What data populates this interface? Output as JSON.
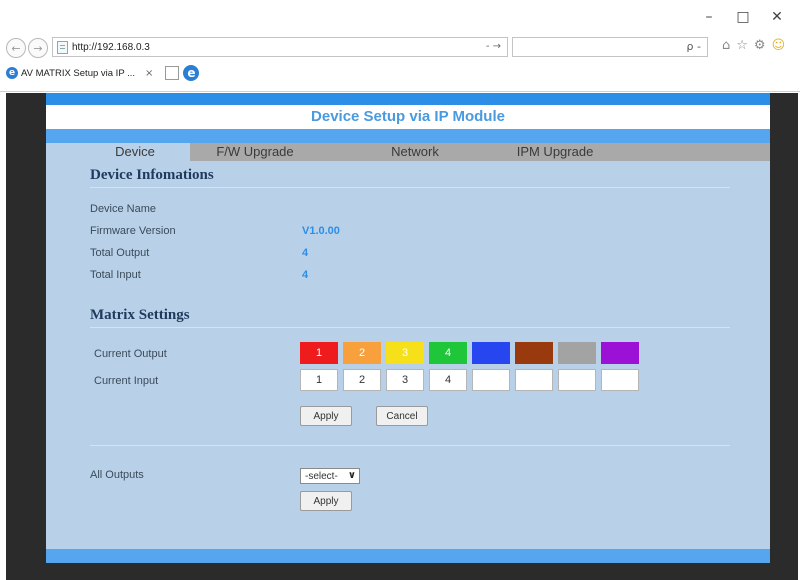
{
  "browser": {
    "url": "http://192.168.0.3",
    "address_right": "- →",
    "search_icon": "ρ -",
    "tab_title": "AV MATRIX Setup via IP ...",
    "tab_close": "×",
    "ie_letter": "e",
    "window_min": "–",
    "window_max": "□",
    "window_close": "✕",
    "tool_icons": [
      "⌂",
      "☆",
      "⚙",
      "☺"
    ],
    "nav_back": "←",
    "nav_forward": "→"
  },
  "page": {
    "title": "Device Setup via IP Module",
    "tabs": [
      {
        "label": "Device"
      },
      {
        "label": "F/W Upgrade"
      },
      {
        "label": "Network"
      },
      {
        "label": "IPM Upgrade"
      }
    ],
    "device_info": {
      "heading": "Device Infomations",
      "fields": [
        {
          "label": "Device Name",
          "value": ""
        },
        {
          "label": "Firmware Version",
          "value": "V1.0.00"
        },
        {
          "label": "Total Output",
          "value": "4"
        },
        {
          "label": "Total Input",
          "value": "4"
        }
      ]
    },
    "matrix": {
      "heading": "Matrix Settings",
      "current_output_label": "Current Output",
      "current_input_label": "Current Input",
      "outputs": [
        {
          "label": "1",
          "color": "#ee1c1c"
        },
        {
          "label": "2",
          "color": "#f7a03c"
        },
        {
          "label": "3",
          "color": "#f6e01a"
        },
        {
          "label": "4",
          "color": "#1fc63a"
        },
        {
          "label": "",
          "color": "#2846f0"
        },
        {
          "label": "",
          "color": "#993a0e"
        },
        {
          "label": "",
          "color": "#a3a3a3"
        },
        {
          "label": "",
          "color": "#9b11d6"
        }
      ],
      "inputs": [
        "1",
        "2",
        "3",
        "4",
        "",
        "",
        "",
        ""
      ],
      "apply_label": "Apply",
      "cancel_label": "Cancel"
    },
    "all_outputs": {
      "label": "All Outputs",
      "select_value": "-select-",
      "apply_label": "Apply"
    }
  }
}
